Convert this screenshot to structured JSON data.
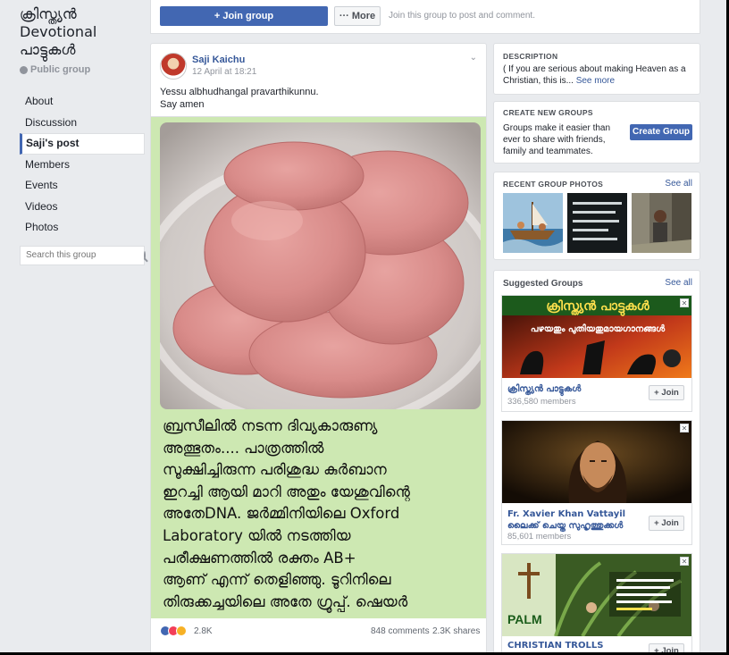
{
  "group": {
    "name": "ക്രിസ്ത്യൻ\nDevotional\nപാട്ടുകൾ",
    "privacy": "Public group"
  },
  "nav": {
    "items": [
      "About",
      "Discussion",
      "Saji's post",
      "Members",
      "Events",
      "Videos",
      "Photos"
    ],
    "active": "Saji's post"
  },
  "search": {
    "placeholder": "Search this group"
  },
  "topbar": {
    "join_label": "+ Join group",
    "more_label": "··· More",
    "note": "Join this group to post and comment."
  },
  "post": {
    "author": "Saji Kaichu",
    "time": "12 April at 18:21",
    "text_line1": "Yessu albhudhangal pravarthikunnu.",
    "text_line2": "Say amen",
    "overlay_text": "ബ്രസീലിൽ നടന്ന ദിവ്യകാരുണ്യ\nഅത്ഭുതം.... പാത്രത്തിൽ\nസൂക്ഷിച്ചിരുന്ന പരിശുദ്ധ കുർബാന\nഇറച്ചി ആയി മാറി അതും യേശുവിന്റെ\nഅതേDNA. ജർമ്മിനിയിലെ Oxford\nLaboratory യിൽ നടത്തിയ\nപരീക്ഷണത്തിൽ രക്തം AB+\nആണ് എന്ന് തെളിഞ്ഞു. ടൂറിനിലെ\nതിരുക്കച്ചയിലെ അതേ ഗ്രൂപ്പ്. ഷെയർ",
    "reactions": "2.8K",
    "comments": "848 comments",
    "shares": "2.3K shares"
  },
  "description": {
    "heading": "DESCRIPTION",
    "text": "( If you are serious about making Heaven as a Christian, this is...",
    "see_more": "See more"
  },
  "create_group": {
    "heading": "CREATE NEW GROUPS",
    "text": "Groups make it easier than ever to share with friends, family and teammates.",
    "button": "Create Group"
  },
  "recent_photos": {
    "heading": "RECENT GROUP PHOTOS",
    "see_all": "See all"
  },
  "suggested": {
    "heading": "Suggested Groups",
    "see_all": "See all",
    "groups": [
      {
        "name": "ക്രിസ്ത്യൻ പാട്ടുകൾ",
        "members": "336,580 members",
        "join": "+ Join",
        "banner_top": "ക്രിസ്ത്യൻ പാട്ടുകൾ",
        "banner_sub": "പഴയതും പുതിയതുമായഗാനങ്ങൾ"
      },
      {
        "name": "Fr. Xavier Khan Vattayil ലൈക്ക് ചെയ്ത സുഹൃത്തുക്കൾ",
        "members": "85,601 members",
        "join": "+ Join"
      },
      {
        "name": "CHRISTIAN TROLLS",
        "members": "",
        "join": "+ Join",
        "banner_label": "PALM"
      }
    ]
  },
  "colors": {
    "brand": "#4267b2",
    "link": "#365899",
    "background": "#e9ebee",
    "media_bg": "#cde8b2"
  }
}
